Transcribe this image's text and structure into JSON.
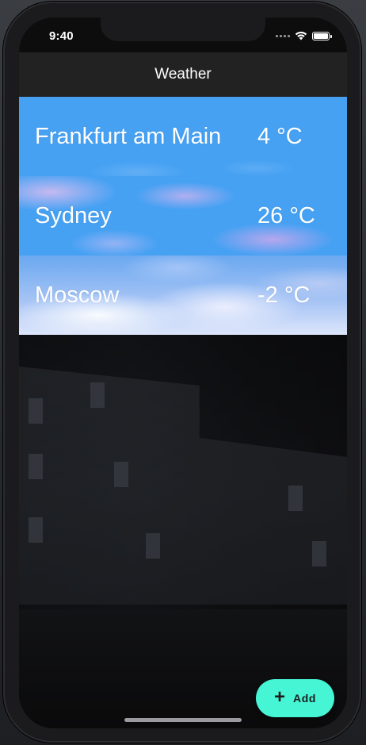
{
  "status_bar": {
    "time": "9:40",
    "icons": [
      "cellular-signal-icon",
      "wifi-icon",
      "battery-icon"
    ]
  },
  "app_bar": {
    "title": "Weather"
  },
  "cities": [
    {
      "name": "Frankfurt am Main",
      "temperature": "4 °C",
      "background": "clear-sky"
    },
    {
      "name": "Sydney",
      "temperature": "26 °C",
      "background": "pink-clouds"
    },
    {
      "name": "Moscow",
      "temperature": "-2 °C",
      "background": "snowy-clouds"
    }
  ],
  "fab": {
    "icon": "plus-icon",
    "label": "Add"
  },
  "colors": {
    "app_bar": "#222222",
    "sky_blue": "#46a1f3",
    "fab": "#46f5d4",
    "text": "#ffffff"
  }
}
